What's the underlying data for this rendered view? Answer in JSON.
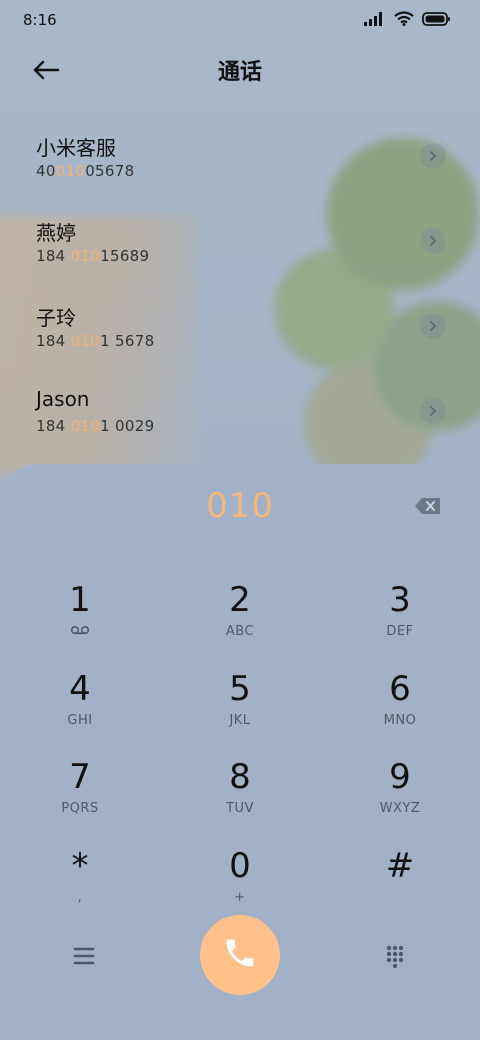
{
  "status_bar": {
    "time": "8:16",
    "icons": [
      "signal-icon",
      "wifi-icon",
      "battery-icon"
    ]
  },
  "header": {
    "title": "通话",
    "back_icon": "back-arrow-icon"
  },
  "contacts": [
    {
      "name": "小米客服",
      "num_pre": "40",
      "num_hl": "010",
      "num_post": "05678"
    },
    {
      "name": "燕婷",
      "num_pre": "184 ",
      "num_hl": "010",
      "num_post": "15689"
    },
    {
      "name": "子玲",
      "num_pre": "184 ",
      "num_hl": "010",
      "num_post": "1 5678"
    },
    {
      "name": "Jason",
      "num_pre": "184 ",
      "num_hl": "010",
      "num_post": "1 0029"
    }
  ],
  "dialpad": {
    "entry": "010",
    "keys": [
      {
        "digit": "1",
        "letters": "voicemail-icon"
      },
      {
        "digit": "2",
        "letters": "ABC"
      },
      {
        "digit": "3",
        "letters": "DEF"
      },
      {
        "digit": "4",
        "letters": "GHI"
      },
      {
        "digit": "5",
        "letters": "JKL"
      },
      {
        "digit": "6",
        "letters": "MNO"
      },
      {
        "digit": "7",
        "letters": "PQRS"
      },
      {
        "digit": "8",
        "letters": "TUV"
      },
      {
        "digit": "9",
        "letters": "WXYZ"
      },
      {
        "digit": "*",
        "letters": ","
      },
      {
        "digit": "0",
        "letters": "+"
      },
      {
        "digit": "#",
        "letters": ""
      }
    ]
  },
  "colors": {
    "accent": "#f6b777",
    "call_button": "#ffc08a",
    "sheet": "#a1b2c8"
  }
}
